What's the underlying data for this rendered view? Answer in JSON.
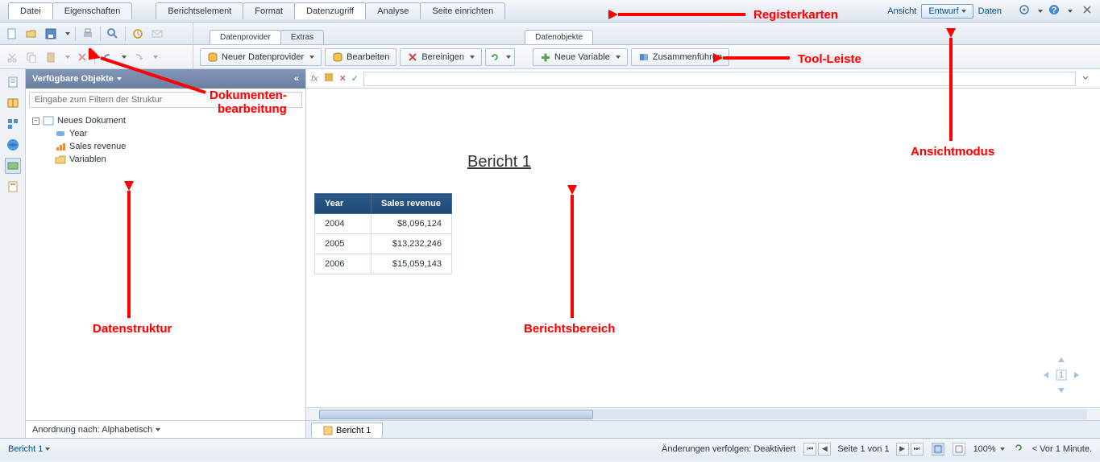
{
  "file_tabs": {
    "datei": "Datei",
    "eigenschaften": "Eigenschaften"
  },
  "main_tabs": {
    "berichtselement": "Berichtselement",
    "format": "Format",
    "datenzugriff": "Datenzugriff",
    "analyse": "Analyse",
    "seite": "Seite einrichten"
  },
  "view": {
    "ansicht": "Ansicht",
    "entwurf": "Entwurf",
    "daten": "Daten"
  },
  "sub_tabs": {
    "datenprovider": "Datenprovider",
    "extras": "Extras",
    "datenobjekte": "Datenobjekte"
  },
  "tools": {
    "neuer_dp": "Neuer Datenprovider",
    "bearbeiten": "Bearbeiten",
    "bereinigen": "Bereinigen",
    "neue_variable": "Neue Variable",
    "zusammenfuehren": "Zusammenführen"
  },
  "panel": {
    "header": "Verfügbare Objekte",
    "filter_placeholder": "Eingabe zum Filtern der Struktur",
    "doc": "Neues Dokument",
    "year": "Year",
    "sales": "Sales revenue",
    "vars": "Variablen",
    "footer": "Anordnung nach: Alphabetisch"
  },
  "report": {
    "title": "Bericht 1",
    "col_year": "Year",
    "col_sales": "Sales revenue",
    "r1_y": "2004",
    "r1_v": "$8,096,124",
    "r2_y": "2005",
    "r2_v": "$13,232,246",
    "r3_y": "2006",
    "r3_v": "$15,059,143",
    "tab": "Bericht 1"
  },
  "status": {
    "doc": "Bericht 1",
    "tracking": "Änderungen verfolgen: Deaktiviert",
    "page": "Seite 1 von 1",
    "zoom": "100%",
    "time": "< Vor 1 Minute."
  },
  "annotations": {
    "registerkarten": "Registerkarten",
    "tool_leiste": "Tool-Leiste",
    "ansichtmodus": "Ansichtmodus",
    "dokumenten": "Dokumenten-\nbearbeitung",
    "datenstruktur": "Datenstruktur",
    "berichtsbereich": "Berichtsbereich"
  }
}
